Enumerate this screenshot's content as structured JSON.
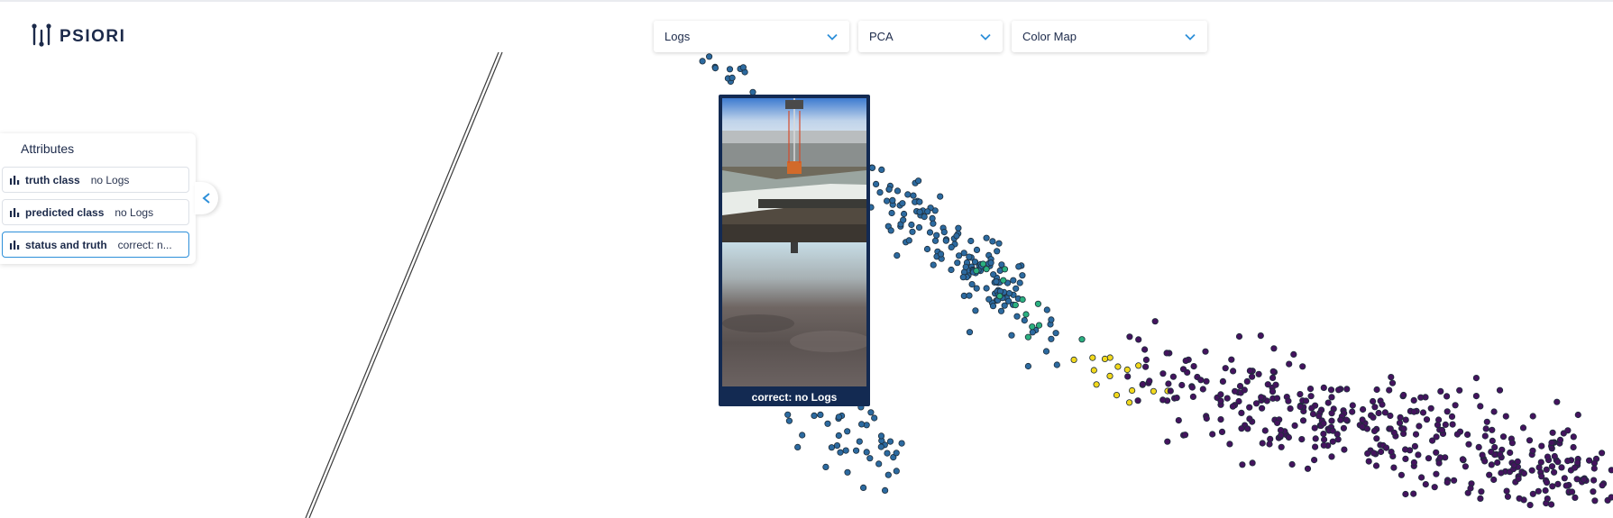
{
  "brand": {
    "name": "PSIORI",
    "logo_icon": "psiori-logo-icon"
  },
  "toolbar": {
    "dropdowns": [
      {
        "value": "Logs"
      },
      {
        "value": "PCA"
      },
      {
        "value": "Color Map"
      }
    ]
  },
  "attributes": {
    "title": "Attributes",
    "rows": [
      {
        "key": "truth class",
        "value": "no Logs"
      },
      {
        "key": "predicted class",
        "value": "no Logs"
      },
      {
        "key": "status and truth",
        "value": "correct: n..."
      }
    ]
  },
  "popup": {
    "caption": "correct: no Logs"
  },
  "colors": {
    "accent": "#2d8fd9",
    "popup_bg": "#132a52",
    "cluster_blue": "#2c6aa0",
    "cluster_green": "#2bb07f",
    "cluster_yellow": "#f2d81c",
    "cluster_purple": "#44135e"
  }
}
